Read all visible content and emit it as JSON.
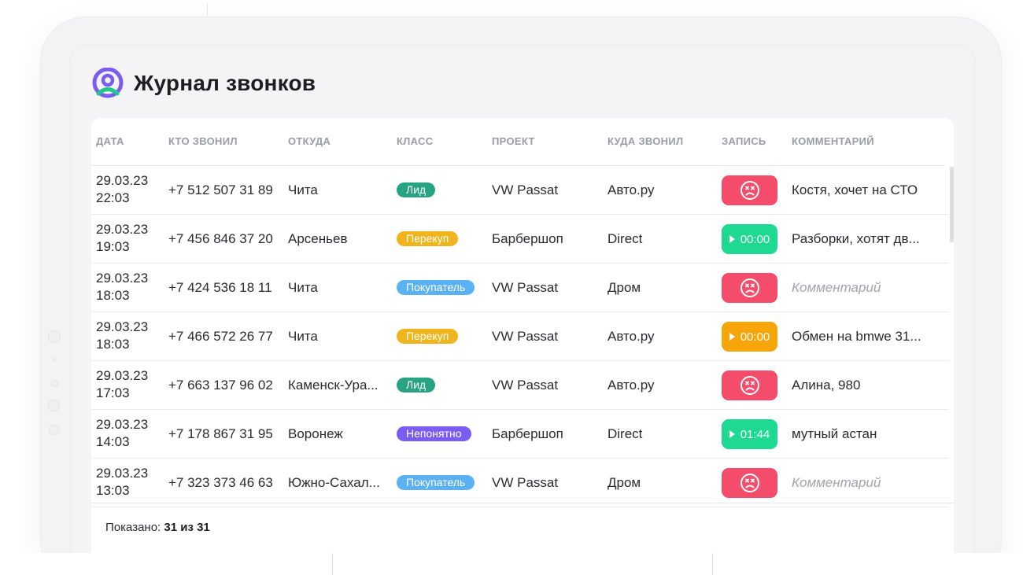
{
  "app": {
    "title": "Журнал звонков",
    "colors": {
      "brand_purple": "#7b5cf0",
      "brand_green": "#1fc98a"
    }
  },
  "table": {
    "headers": {
      "date": "Дата",
      "caller": "Кто звонил",
      "from": "Откуда",
      "class": "Класс",
      "project": "Проект",
      "called_to": "Куда звонил",
      "record": "Запись",
      "comment": "Комментарий"
    },
    "rows": [
      {
        "date": "29.03.23 22:03",
        "phone": "+7 512 507 31 89",
        "city": "Чита",
        "class": "Лид",
        "class_color": "#27a382",
        "project": "VW Passat",
        "called_to": "Авто.ру",
        "record": {
          "type": "missed",
          "duration": "",
          "color": "#f44d6b",
          "icon": "sad-face-icon"
        },
        "comment": "Костя, хочет на СТО",
        "comment_placeholder": false
      },
      {
        "date": "29.03.23 19:03",
        "phone": "+7 456 846 37 20",
        "city": "Арсеньев",
        "class": "Перекуп",
        "class_color": "#f0b41c",
        "project": "Барбершоп",
        "called_to": "Direct",
        "record": {
          "type": "play",
          "duration": "00:00",
          "color": "#1ed992",
          "icon": "play-icon"
        },
        "comment": "Разборки, хотят дв...",
        "comment_placeholder": false
      },
      {
        "date": "29.03.23 18:03",
        "phone": "+7 424 536 18 11",
        "city": "Чита",
        "class": "Покупатель",
        "class_color": "#5ab2f5",
        "project": "VW Passat",
        "called_to": "Дром",
        "record": {
          "type": "missed",
          "duration": "",
          "color": "#f44d6b",
          "icon": "sad-face-icon"
        },
        "comment": "Комментарий",
        "comment_placeholder": true
      },
      {
        "date": "29.03.23 18:03",
        "phone": "+7 466 572 26 77",
        "city": "Чита",
        "class": "Перекуп",
        "class_color": "#f0b41c",
        "project": "VW Passat",
        "called_to": "Авто.ру",
        "record": {
          "type": "play",
          "duration": "00:00",
          "color": "#f6a609",
          "icon": "play-icon"
        },
        "comment": "Обмен на bmwe 31...",
        "comment_placeholder": false
      },
      {
        "date": "29.03.23 17:03",
        "phone": "+7 663 137 96 02",
        "city": "Каменск-Ура...",
        "class": "Лид",
        "class_color": "#27a382",
        "project": "VW Passat",
        "called_to": "Авто.ру",
        "record": {
          "type": "missed",
          "duration": "",
          "color": "#f44d6b",
          "icon": "sad-face-icon"
        },
        "comment": "Алина, 980",
        "comment_placeholder": false
      },
      {
        "date": "29.03.23 14:03",
        "phone": "+7 178 867 31 95",
        "city": "Воронеж",
        "class": "Непонятно",
        "class_color": "#7b5cf0",
        "project": "Барбершоп",
        "called_to": "Direct",
        "record": {
          "type": "play",
          "duration": "01:44",
          "color": "#1ed992",
          "icon": "play-icon"
        },
        "comment": "мутный астан",
        "comment_placeholder": false
      },
      {
        "date": "29.03.23 13:03",
        "phone": "+7 323 373 46 63",
        "city": "Южно-Сахал...",
        "class": "Покупатель",
        "class_color": "#5ab2f5",
        "project": "VW Passat",
        "called_to": "Дром",
        "record": {
          "type": "missed",
          "duration": "",
          "color": "#f44d6b",
          "icon": "sad-face-icon"
        },
        "comment": "Комментарий",
        "comment_placeholder": true
      }
    ]
  },
  "footer": {
    "shown_label": "Показано:",
    "shown_value": "31 из 31"
  }
}
